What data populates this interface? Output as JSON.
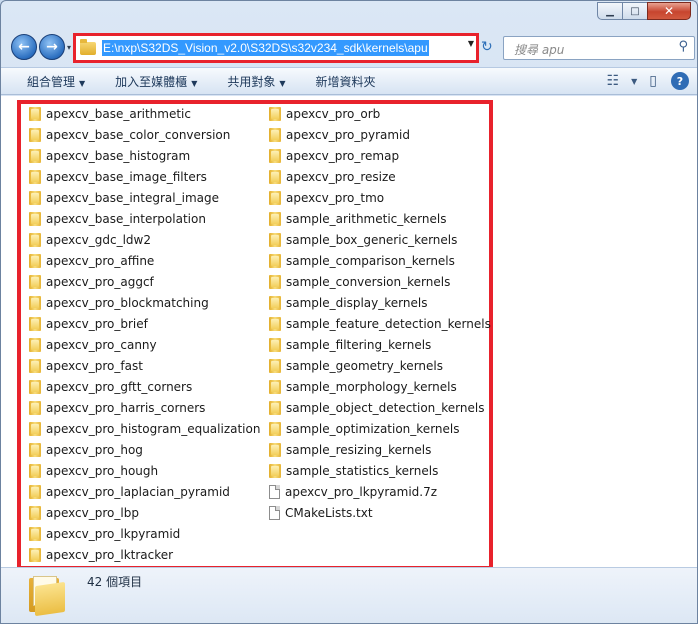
{
  "window": {
    "caption": {
      "minimize": "▁",
      "maximize": "□",
      "close": "✕"
    }
  },
  "nav": {
    "back_icon": "arrow-left-icon",
    "forward_icon": "arrow-right-icon",
    "address": "E:\\nxp\\S32DS_Vision_v2.0\\S32DS\\s32v234_sdk\\kernels\\apu",
    "search_placeholder": "搜尋 apu"
  },
  "toolbar": {
    "organize": "組合管理",
    "add_to_library": "加入至媒體櫃",
    "share_with": "共用對象",
    "new_folder": "新增資料夾"
  },
  "files_col1": [
    {
      "name": "apexcv_base_arithmetic",
      "type": "folder"
    },
    {
      "name": "apexcv_base_color_conversion",
      "type": "folder"
    },
    {
      "name": "apexcv_base_histogram",
      "type": "folder"
    },
    {
      "name": "apexcv_base_image_filters",
      "type": "folder"
    },
    {
      "name": "apexcv_base_integral_image",
      "type": "folder"
    },
    {
      "name": "apexcv_base_interpolation",
      "type": "folder"
    },
    {
      "name": "apexcv_gdc_ldw2",
      "type": "folder"
    },
    {
      "name": "apexcv_pro_affine",
      "type": "folder"
    },
    {
      "name": "apexcv_pro_aggcf",
      "type": "folder"
    },
    {
      "name": "apexcv_pro_blockmatching",
      "type": "folder"
    },
    {
      "name": "apexcv_pro_brief",
      "type": "folder"
    },
    {
      "name": "apexcv_pro_canny",
      "type": "folder"
    },
    {
      "name": "apexcv_pro_fast",
      "type": "folder"
    },
    {
      "name": "apexcv_pro_gftt_corners",
      "type": "folder"
    },
    {
      "name": "apexcv_pro_harris_corners",
      "type": "folder"
    },
    {
      "name": "apexcv_pro_histogram_equalization",
      "type": "folder"
    },
    {
      "name": "apexcv_pro_hog",
      "type": "folder"
    },
    {
      "name": "apexcv_pro_hough",
      "type": "folder"
    },
    {
      "name": "apexcv_pro_laplacian_pyramid",
      "type": "folder"
    },
    {
      "name": "apexcv_pro_lbp",
      "type": "folder"
    },
    {
      "name": "apexcv_pro_lkpyramid",
      "type": "folder"
    },
    {
      "name": "apexcv_pro_lktracker",
      "type": "folder"
    }
  ],
  "files_col2": [
    {
      "name": "apexcv_pro_orb",
      "type": "folder"
    },
    {
      "name": "apexcv_pro_pyramid",
      "type": "folder"
    },
    {
      "name": "apexcv_pro_remap",
      "type": "folder"
    },
    {
      "name": "apexcv_pro_resize",
      "type": "folder"
    },
    {
      "name": "apexcv_pro_tmo",
      "type": "folder"
    },
    {
      "name": "sample_arithmetic_kernels",
      "type": "folder"
    },
    {
      "name": "sample_box_generic_kernels",
      "type": "folder"
    },
    {
      "name": "sample_comparison_kernels",
      "type": "folder"
    },
    {
      "name": "sample_conversion_kernels",
      "type": "folder"
    },
    {
      "name": "sample_display_kernels",
      "type": "folder"
    },
    {
      "name": "sample_feature_detection_kernels",
      "type": "folder"
    },
    {
      "name": "sample_filtering_kernels",
      "type": "folder"
    },
    {
      "name": "sample_geometry_kernels",
      "type": "folder"
    },
    {
      "name": "sample_morphology_kernels",
      "type": "folder"
    },
    {
      "name": "sample_object_detection_kernels",
      "type": "folder"
    },
    {
      "name": "sample_optimization_kernels",
      "type": "folder"
    },
    {
      "name": "sample_resizing_kernels",
      "type": "folder"
    },
    {
      "name": "sample_statistics_kernels",
      "type": "folder"
    },
    {
      "name": "apexcv_pro_lkpyramid.7z",
      "type": "file"
    },
    {
      "name": "CMakeLists.txt",
      "type": "file"
    }
  ],
  "status": {
    "item_count": "42 個項目"
  },
  "colors": {
    "highlight": "#e8222c",
    "selection": "#3399ff"
  }
}
